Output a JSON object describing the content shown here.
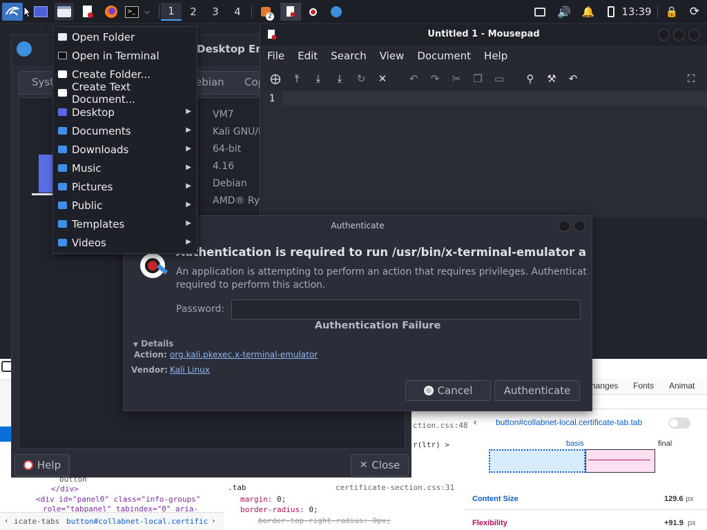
{
  "panel": {
    "workspaces": [
      "1",
      "2",
      "3",
      "4"
    ],
    "notification_badge": "2",
    "clock": "13:39"
  },
  "places_menu": {
    "items": [
      {
        "label": "Open Folder",
        "icon": "folder-icon",
        "submenu": false
      },
      {
        "label": "Open in Terminal",
        "icon": "terminal-icon",
        "submenu": false
      },
      {
        "label": "Create Folder...",
        "icon": "add-folder-icon",
        "submenu": false
      },
      {
        "label": "Create Text Document...",
        "icon": "add-document-icon",
        "submenu": false
      },
      {
        "label": "Desktop",
        "icon": "desktop-folder-icon",
        "submenu": true
      },
      {
        "label": "Documents",
        "icon": "documents-folder-icon",
        "submenu": true
      },
      {
        "label": "Downloads",
        "icon": "downloads-folder-icon",
        "submenu": true
      },
      {
        "label": "Music",
        "icon": "music-folder-icon",
        "submenu": true
      },
      {
        "label": "Pictures",
        "icon": "pictures-folder-icon",
        "submenu": true
      },
      {
        "label": "Public",
        "icon": "public-folder-icon",
        "submenu": true
      },
      {
        "label": "Templates",
        "icon": "templates-folder-icon",
        "submenu": true
      },
      {
        "label": "Videos",
        "icon": "videos-folder-icon",
        "submenu": true
      }
    ]
  },
  "about_window": {
    "title_partial": "Desktop Envi",
    "tabs": [
      "Syst",
      "ebian",
      "Cop"
    ],
    "info": [
      "VM7",
      "Kali GNU/Lin",
      "64-bit",
      "4.16",
      "Debian",
      "AMD® Ryzen"
    ],
    "help_label": "Help",
    "close_label": "Close"
  },
  "mousepad": {
    "title": "Untitled 1 - Mousepad",
    "menu": [
      "File",
      "Edit",
      "Search",
      "View",
      "Document",
      "Help"
    ],
    "line_number": "1"
  },
  "auth_dialog": {
    "title": "Authenticate",
    "heading": "Authentication is required to run /usr/bin/x-terminal-emulator as root",
    "message_line1": "An application is attempting to perform an action that requires privileges. Authentication is",
    "message_line2": "required to perform this action.",
    "password_label": "Password:",
    "password_value": "",
    "failure": "Authentication Failure",
    "details_label": "Details",
    "action_label": "Action:",
    "action_value": "org.kali.pkexec.x-terminal-emulator",
    "vendor_label": "Vendor:",
    "vendor_value": "Kali Linux",
    "cancel_label": "Cancel",
    "auth_label": "Authenticate"
  },
  "devtools": {
    "tabs": [
      "hanges",
      "Fonts",
      "Animat"
    ],
    "selector": "button#collabnet-local.certificate-tab.tab",
    "file1": "ction.css:48",
    "file1_line": "r(ltr) >",
    "basis": "basis",
    "final": "final",
    "content_size_label": "Content Size",
    "content_size_value": "129.6",
    "unit_px": "px",
    "flexibility_label": "Flexibility",
    "flexibility_value": "+91.9",
    "html_line1": "</div>",
    "html_line2": "<div id=\"panel0\" class=\"info-groups\"",
    "html_line3": "role=\"tabpanel\" tabindex=\"0\" aria-",
    "html_button": "button",
    "rule_selector": ".tab",
    "rule_source": "certificate-section.css:31",
    "prop1": "margin: ",
    "prop1_val": "0;",
    "prop2": "border-radius: ",
    "prop2_val": "0;",
    "prop3": "border-top-right-radius: 0px;",
    "breadcrumb1": "icate-tabs",
    "breadcrumb2": "button#collabnet-local.certificate-tab.t..."
  }
}
